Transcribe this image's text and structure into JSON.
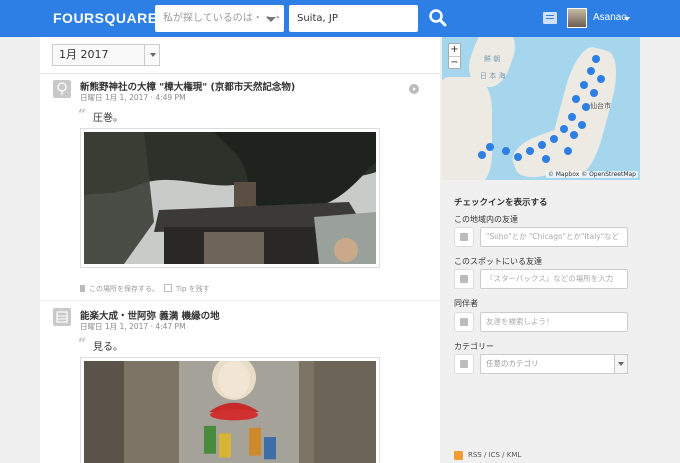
{
  "header": {
    "logo": "FOURSQUARE",
    "search_what_placeholder": "私が探しているのは・・・",
    "search_where_value": "Suita, JP",
    "user_name": "Asanao"
  },
  "filter": {
    "month": "1月 2017"
  },
  "entries": [
    {
      "venue": "新熊野神社の大樟 \"樟大権現\" (京都市天然記念物)",
      "time": "日曜日 1月 1, 2017 · 4:49 PM",
      "shout": "圧巻。",
      "save_label": "この場所を保存する。",
      "tip_label": "Tip を残す"
    },
    {
      "venue": "能楽大成・世阿弥 義満 機縁の地",
      "time": "日曜日 1月 1, 2017 · 4:47 PM",
      "shout": "見る。"
    }
  ],
  "map": {
    "zoom_in": "+",
    "zoom_out": "−",
    "attribution": "© Mapbox © OpenStreetMap",
    "labels": [
      "鮮 朝",
      "日 本 海",
      "仙台市"
    ]
  },
  "sidebar": {
    "heading": "チェックインを表示する",
    "friends_area_label": "この地域内の友達",
    "friends_area_placeholder": "\"Soho\"とか \"Chicago\"とか\"Italy\"など",
    "friends_spot_label": "このスポットにいる友達",
    "friends_spot_placeholder": "『スターバックス』などの場所を入力",
    "companion_label": "同伴者",
    "companion_placeholder": "友達を検索しよう！",
    "category_label": "カテゴリー",
    "category_value": "任意のカテゴリ",
    "rss": "RSS / ICS / KML"
  }
}
